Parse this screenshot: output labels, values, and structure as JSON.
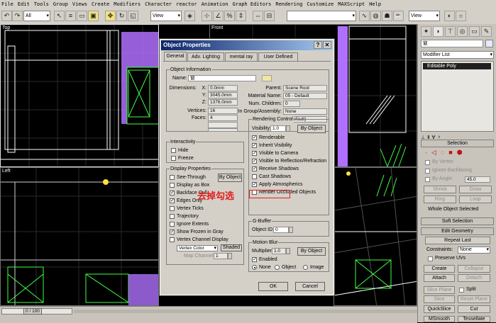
{
  "menu": [
    "File",
    "Edit",
    "Tools",
    "Group",
    "Views",
    "Create",
    "Modifiers",
    "Character",
    "reactor",
    "Animation",
    "Graph Editors",
    "Rendering",
    "Customize",
    "MAXScript",
    "Help"
  ],
  "toolbar": {
    "selection_filter": "All",
    "ref_coord_left": "View",
    "ref_coord_right": "View"
  },
  "viewports": {
    "top_label": "Top",
    "front_label": "Front",
    "left_label": "Left"
  },
  "dialog": {
    "title": "Object Properties",
    "tabs": [
      "General",
      "Adv. Lighting",
      "mental ray",
      "User Defined"
    ],
    "object_info": {
      "group_title": "Object Information",
      "name_label": "Name:",
      "name_value": "窗",
      "dimensions_label": "Dimensions:",
      "x_label": "X:",
      "x_value": "0.0mm",
      "y_label": "Y:",
      "y_value": "3045.0mm",
      "z_label": "Z:",
      "z_value": "1376.0mm",
      "vertices_label": "Vertices:",
      "vertices_value": "16",
      "faces_label": "Faces:",
      "faces_value": "4",
      "parent_label": "Parent:",
      "parent_value": "Scene Root",
      "material_label": "Material Name:",
      "material_value": "05 - Default",
      "children_label": "Num. Children:",
      "children_value": "0",
      "group_label": "In Group/Assembly:",
      "group_value": "None",
      "layer_label": "Layer:",
      "layer_value": "0 (default)"
    },
    "interactivity": {
      "group_title": "Interactivity",
      "hide": "Hide",
      "freeze": "Freeze"
    },
    "display_properties": {
      "group_title": "Display Properties",
      "by_object": "By Object",
      "items": [
        "See-Through",
        "Display as Box",
        "Backface Cull",
        "Edges Only",
        "Vertex Ticks",
        "Trajectory",
        "Ignore Extents",
        "Show Frozen in Gray",
        "Vertex Channel Display"
      ],
      "checked": [
        false,
        false,
        true,
        true,
        false,
        false,
        false,
        true,
        false
      ],
      "vertex_color": "Vertex Color",
      "shaded": "Shaded",
      "map_channel": "Map Channel:",
      "map_channel_value": "1"
    },
    "rendering_control": {
      "group_title": "Rendering Control",
      "visibility_label": "Visibility:",
      "visibility_value": "1.0",
      "by_object": "By Object",
      "items": [
        "Renderable",
        "Inherit Visibility",
        "Visible to Camera",
        "Visible to Reflection/Refraction",
        "Receive Shadows",
        "Cast Shadows",
        "Apply Atmospherics",
        "Render Occluded Objects"
      ],
      "checked": [
        true,
        true,
        true,
        true,
        true,
        false,
        true,
        false
      ]
    },
    "gbuffer": {
      "group_title": "G-Buffer",
      "object_id_label": "Object ID:",
      "object_id_value": "0"
    },
    "motion_blur": {
      "group_title": "Motion Blur",
      "multiplier_label": "Multiplier:",
      "multiplier_value": "1.0",
      "by_object": "By Object",
      "enabled": "Enabled",
      "options": [
        "None",
        "Object",
        "Image"
      ],
      "selected": "None"
    },
    "ok": "OK",
    "cancel": "Cancel",
    "annotation": "去掉勾选"
  },
  "command_panel": {
    "object_name": "窗",
    "modifier_list": "Modifier List",
    "stack_item": "Editable Poly",
    "selection_title": "Selection",
    "by_vertex": "By Vertex",
    "ignore_backfacing": "Ignore Backfacing",
    "by_angle": "By Angle:",
    "by_angle_value": "45.0",
    "shrink": "Shrink",
    "grow": "Grow",
    "ring": "Ring",
    "loop": "Loop",
    "whole_object": "Whole Object Selected",
    "soft_selection": "Soft Selection",
    "edit_geometry": "Edit Geometry",
    "repeat_last": "Repeat Last",
    "constraints_label": "Constraints:",
    "constraints_value": "None",
    "preserve_uvs": "Preserve UVs",
    "create": "Create",
    "collapse": "Collapse",
    "attach": "Attach",
    "detach": "Detach",
    "slice_plane": "Slice Plane",
    "split": "Split",
    "slice": "Slice",
    "reset_plane": "Reset Plane",
    "quickslice": "QuickSlice",
    "cut": "Cut",
    "msmooth": "MSmooth",
    "tessellate": "Tessellate"
  },
  "status": {
    "frame": "0 / 100"
  },
  "colors": {
    "titlebar_start": "#0a246a",
    "titlebar_end": "#a6caf0",
    "annotation_red": "#e02020",
    "selection_purple": "#a040e0"
  }
}
